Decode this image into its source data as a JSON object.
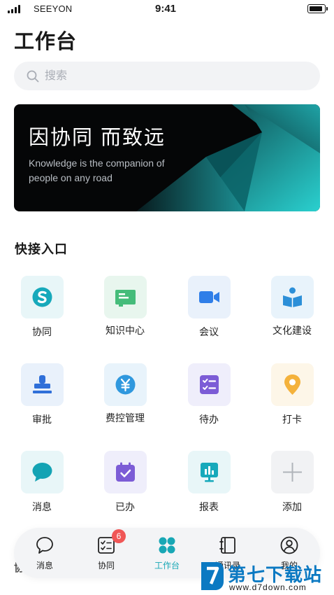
{
  "status_bar": {
    "carrier": "SEEYON",
    "time": "9:41"
  },
  "header": {
    "title": "工作台"
  },
  "search": {
    "placeholder": "搜索"
  },
  "banner": {
    "title": "因协同 而致远",
    "subtitle": "Knowledge is the companion of people on any road"
  },
  "shortcuts": {
    "title": "快接入口",
    "items": [
      {
        "label": "协同",
        "icon": "collaboration-icon",
        "bg": "#e8f6f8",
        "color": "#17a9bb"
      },
      {
        "label": "知识中心",
        "icon": "knowledge-board-icon",
        "bg": "#e8f6ee",
        "color": "#45bc7a"
      },
      {
        "label": "会议",
        "icon": "video-camera-icon",
        "bg": "#e9f1fb",
        "color": "#2f7ee8"
      },
      {
        "label": "文化建设",
        "icon": "reading-person-icon",
        "bg": "#e8f3fb",
        "color": "#2c8fd8"
      },
      {
        "label": "审批",
        "icon": "stamp-icon",
        "bg": "#e9f1fb",
        "color": "#2f6fd9"
      },
      {
        "label": "费控管理",
        "icon": "yuan-coin-icon",
        "bg": "#e8f3fb",
        "color": "#2f98de"
      },
      {
        "label": "待办",
        "icon": "checklist-icon",
        "bg": "#efeefb",
        "color": "#7c5cd6"
      },
      {
        "label": "打卡",
        "icon": "location-pin-icon",
        "bg": "#fdf6e8",
        "color": "#f4b23c"
      },
      {
        "label": "消息",
        "icon": "chat-bubble-icon",
        "bg": "#e8f6f8",
        "color": "#14a3b4"
      },
      {
        "label": "已办",
        "icon": "calendar-check-icon",
        "bg": "#efeefb",
        "color": "#7c5cd6"
      },
      {
        "label": "报表",
        "icon": "chart-board-icon",
        "bg": "#e8f6f8",
        "color": "#17a9bb"
      },
      {
        "label": "添加",
        "icon": "plus-icon",
        "bg": "#f1f2f4",
        "color": "#b0b4ba"
      }
    ]
  },
  "tabbar": {
    "items": [
      {
        "label": "消息",
        "icon": "chat-outline-icon"
      },
      {
        "label": "协同",
        "icon": "task-list-icon",
        "badge": "6"
      },
      {
        "label": "工作台",
        "icon": "workbench-dots-icon",
        "active": true
      },
      {
        "label": "通讯录",
        "icon": "address-book-icon"
      },
      {
        "label": "我的",
        "icon": "profile-icon"
      }
    ],
    "accent": "#18a7b5"
  },
  "peek_text": "协",
  "watermark": {
    "name": "第七下载站",
    "url": "www.d7down.com",
    "color": "#0b79c2"
  }
}
